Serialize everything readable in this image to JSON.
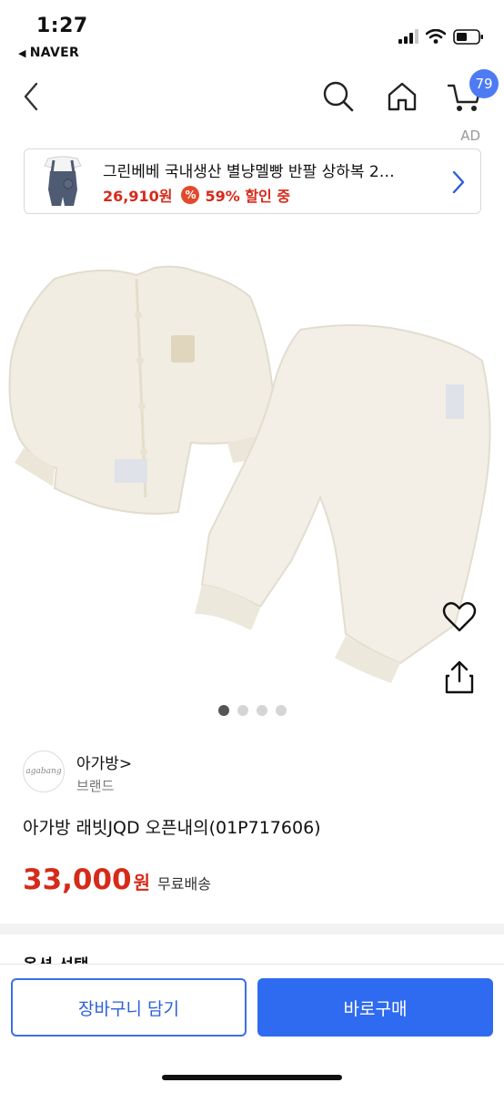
{
  "status_bar": {
    "time": "1:27",
    "back_app": "NAVER"
  },
  "nav": {
    "cart_badge": "79"
  },
  "ad": {
    "label": "AD",
    "title": "그린베베 국내생산 별냥멜빵 반팔 상하복 2…",
    "price": "26,910원",
    "discount_icon": "%",
    "discount": "59% 할인 중"
  },
  "product": {
    "brand_logo": "agabang",
    "brand_name": "아가방>",
    "brand_sub": "브랜드",
    "title": "아가방 래빗JQD 오픈내의(01P717606)",
    "price": "33,000",
    "price_unit": "원",
    "shipping": "무료배송",
    "image_count": 4,
    "active_image": 1
  },
  "option_peek": "옵션 선택",
  "buttons": {
    "cart": "장바구니 담기",
    "buy": "바로구매"
  },
  "colors": {
    "accent": "#2f6bf0",
    "price": "#d62a1a",
    "badge": "#4d7bf3"
  }
}
